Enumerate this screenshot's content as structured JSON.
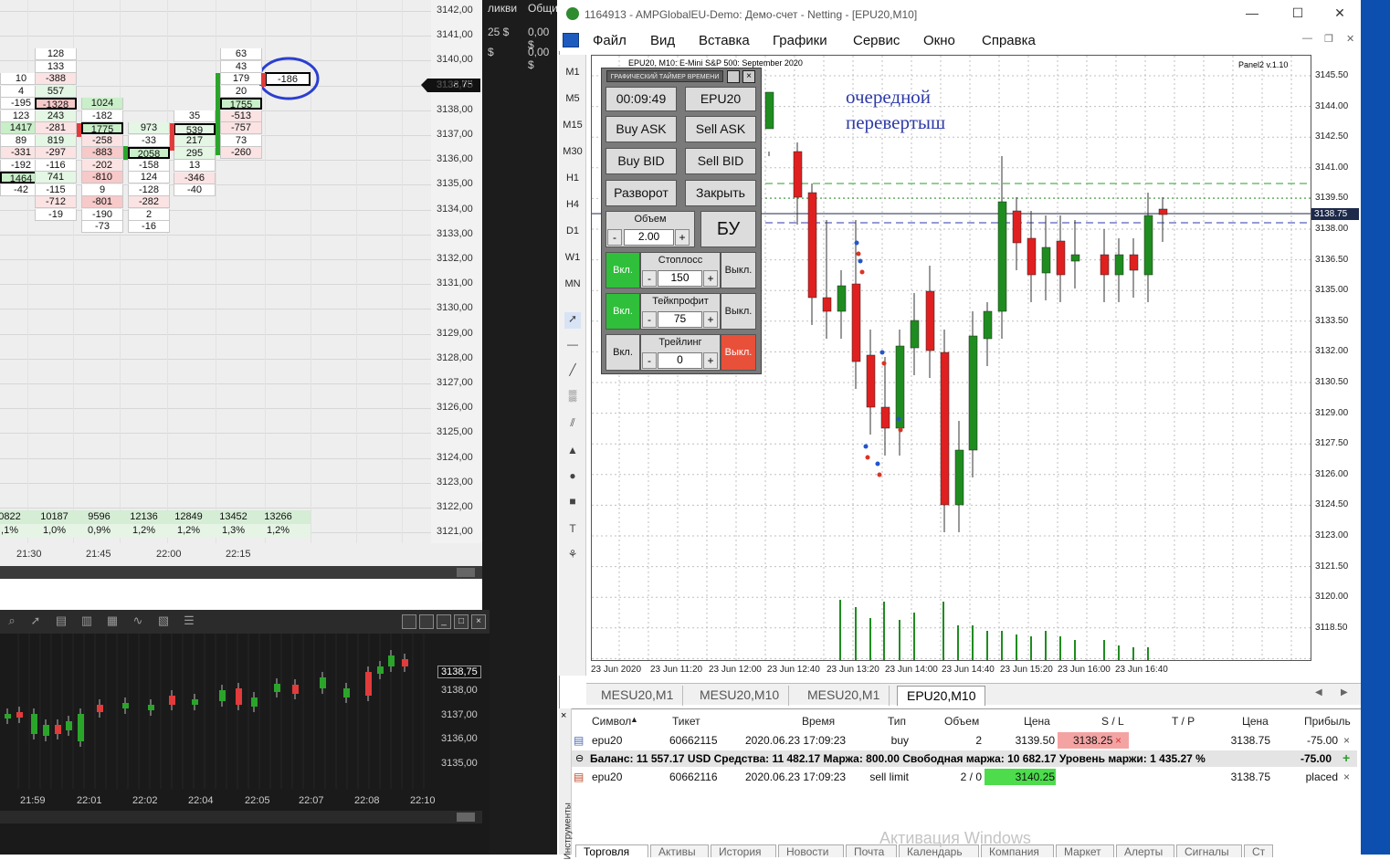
{
  "footprint": {
    "price_ticks": [
      "3142,00",
      "3141,00",
      "3140,00",
      "3139,00",
      "3138,00",
      "3137,00",
      "3136,00",
      "3135,00",
      "3134,00",
      "3133,00",
      "3132,00",
      "3131,00",
      "3130,00",
      "3129,00",
      "3128,00",
      "3127,00",
      "3126,00",
      "3125,00",
      "3124,00",
      "3123,00",
      "3122,00",
      "3121,00"
    ],
    "current_price": "3138,75",
    "columns": [
      [
        "10",
        "4",
        "-195",
        "123",
        "1417",
        "89",
        "-331",
        "-192",
        "1464",
        "-42"
      ],
      [
        "128",
        "133",
        "-388",
        "557",
        "-1328",
        "243",
        "-281",
        "819",
        "-297",
        "-116",
        "741",
        "-115",
        "-712",
        "-19"
      ],
      [
        "1024",
        "-182",
        "1775",
        "-258",
        "-883",
        "-202",
        "-810",
        "9",
        "-801",
        "-190",
        "-73"
      ],
      [
        "973",
        "-33",
        "2058",
        "-158",
        "124",
        "-128",
        "-282",
        "2",
        "-16"
      ],
      [
        "35",
        "539",
        "217",
        "295",
        "13",
        "-346",
        "-40"
      ],
      [
        "63",
        "43",
        "179",
        "20",
        "1755",
        "-513",
        "-757",
        "73",
        "-260"
      ]
    ],
    "highlight_value": "-186",
    "volume_row": [
      "0822",
      "10187",
      "9596",
      "12136",
      "12849",
      "13452",
      "13266"
    ],
    "percent_row": [
      ",1%",
      "1,0%",
      "0,9%",
      "1,2%",
      "1,2%",
      "1,3%",
      "1,2%"
    ],
    "time_labels": [
      "21:30",
      "21:45",
      "22:00",
      "22:15"
    ]
  },
  "liquidity": {
    "header1": "ликви",
    "header2": "Общи",
    "val1": "25 $",
    "val2": "0,00 $",
    "val3": "$",
    "val4": "0,00 $"
  },
  "dark_chart": {
    "price_ticks": [
      "3138,75",
      "3138,00",
      "3137,00",
      "3136,00",
      "3135,00"
    ],
    "time_labels": [
      "21:59",
      "22:01",
      "22:02",
      "22:04",
      "22:05",
      "22:07",
      "22:08",
      "22:10"
    ]
  },
  "mt5": {
    "title": "1164913 - AMPGlobalEU-Demo: Демо-счет - Netting - [EPU20,M10]",
    "menu": [
      "Файл",
      "Вид",
      "Вставка",
      "Графики",
      "Сервис",
      "Окно",
      "Справка"
    ],
    "timeframes": [
      "M1",
      "M5",
      "M15",
      "M30",
      "H1",
      "H4",
      "D1",
      "W1",
      "MN"
    ],
    "chart_header": "EPU20, M10:  E-Mini S&P 500: September 2020",
    "panel_version": "Panel2 v.1.10",
    "annotation_line1": "очередной",
    "annotation_line2": "перевертыш",
    "price_ticks": [
      "3145.50",
      "3144.00",
      "3142.50",
      "3141.00",
      "3139.50",
      "3138.00",
      "3136.50",
      "3135.00",
      "3133.50",
      "3132.00",
      "3130.50",
      "3129.00",
      "3127.50",
      "3126.00",
      "3124.50",
      "3123.00",
      "3121.50",
      "3120.00",
      "3118.50"
    ],
    "current_price": "3138.75",
    "x_labels": [
      "23 Jun 2020",
      "23 Jun 11:20",
      "23 Jun 12:00",
      "23 Jun 12:40",
      "23 Jun 13:20",
      "23 Jun 14:00",
      "23 Jun 14:40",
      "23 Jun 15:20",
      "23 Jun 16:00",
      "23 Jun 16:40"
    ],
    "trade_panel": {
      "title": "ГРАФИЧЕСКИЙ ТАЙМЕР ВРЕМЕНИ",
      "timer": "00:09:49",
      "symbol": "EPU20",
      "buy_ask": "Buy ASK",
      "sell_ask": "Sell ASK",
      "buy_bid": "Buy BID",
      "sell_bid": "Sell BID",
      "reverse": "Разворот",
      "close": "Закрыть",
      "volume_label": "Объем",
      "volume": "2.00",
      "breakeven": "БУ",
      "stoploss_label": "Стоплосс",
      "stoploss": "150",
      "takeprofit_label": "Тейкпрофит",
      "takeprofit": "75",
      "trailing_label": "Трейлинг",
      "trailing": "0",
      "on": "Вкл.",
      "off": "Выкл.",
      "minus": "-",
      "plus": "+"
    },
    "tabs": [
      "MESU20,M1",
      "MESU20,M10",
      "MESU20,M1",
      "EPU20,M10"
    ],
    "table": {
      "headers": [
        "Символ",
        "Тикет",
        "Время",
        "Тип",
        "Объем",
        "Цена",
        "S / L",
        "T / P",
        "Цена",
        "Прибыль"
      ],
      "rows": [
        [
          "epu20",
          "60662115",
          "2020.06.23 17:09:23",
          "buy",
          "2",
          "3139.50",
          "3138.25",
          "",
          "3138.75",
          "-75.00"
        ],
        [
          "epu20",
          "60662116",
          "2020.06.23 17:09:23",
          "sell limit",
          "2 / 0",
          "3140.25",
          "",
          "",
          "3138.75",
          "placed"
        ]
      ],
      "balance": "Баланс: 11 557.17 USD  Средства: 11 482.17  Маржа: 800.00  Свободная маржа: 10 682.17  Уровень маржи: 1 435.27 %",
      "balance_profit": "-75.00"
    },
    "bottom_tabs": [
      "Торговля",
      "Активы",
      "История",
      "Новости",
      "Почта",
      "Календарь",
      "Компания",
      "Маркет",
      "Алерты",
      "Сигналы",
      "Ст"
    ],
    "side_label": "Инструменты",
    "watermark": "Активация Windows"
  }
}
